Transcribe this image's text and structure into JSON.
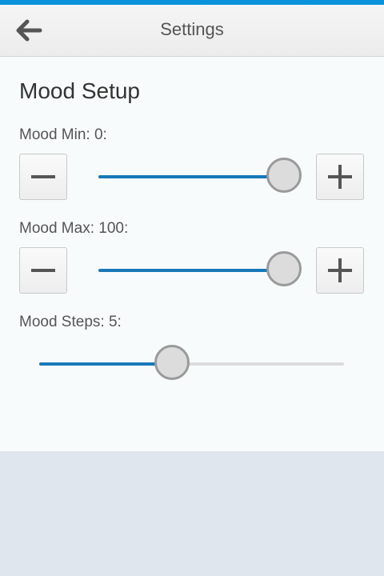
{
  "header": {
    "title": "Settings"
  },
  "section": {
    "title": "Mood Setup"
  },
  "mood_min": {
    "label": "Mood Min: 0:",
    "fill_fraction": 1.0
  },
  "mood_max": {
    "label": "Mood Max: 100:",
    "fill_fraction": 1.0
  },
  "mood_steps": {
    "label": "Mood Steps: 5:",
    "fill_fraction": 0.44
  },
  "colors": {
    "accent": "#0a93dc",
    "slider_fill": "#1878b8",
    "track": "#dcdcdc",
    "panel_bg": "#f8fbfc",
    "page_bg": "#dfe6ed"
  },
  "icons": {
    "back": "arrow-left-icon",
    "decrement": "minus-icon",
    "increment": "plus-icon"
  }
}
